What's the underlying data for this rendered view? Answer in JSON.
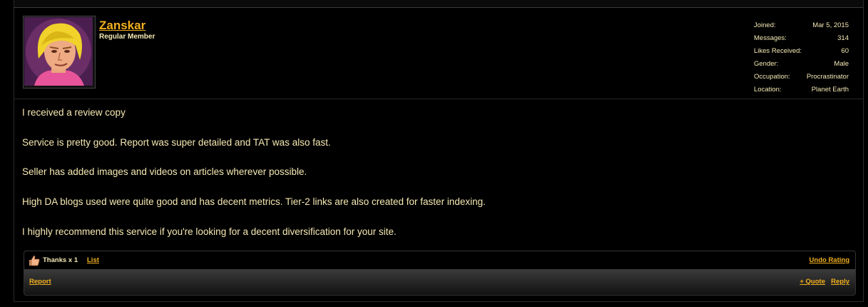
{
  "user": {
    "name": "Zanskar",
    "title": "Regular Member",
    "avatar_icon": "cartoon-hero-avatar",
    "stats": [
      {
        "label": "Joined:",
        "value": "Mar 5, 2015"
      },
      {
        "label": "Messages:",
        "value": "314"
      },
      {
        "label": "Likes Received:",
        "value": "60"
      },
      {
        "label": "Gender:",
        "value": "Male"
      },
      {
        "label": "Occupation:",
        "value": "Procrastinator"
      },
      {
        "label": "Location:",
        "value": "Planet Earth"
      }
    ]
  },
  "post": {
    "paragraphs": [
      "I received a review copy",
      "Service is pretty good. Report was super detailed and TAT was also fast.",
      "Seller has added images and videos on articles wherever possible.",
      "High DA blogs used were quite good and has decent metrics. Tier-2 links are also created for faster indexing.",
      "I highly recommend this service if you're looking for a decent diversification for your site."
    ]
  },
  "likes": {
    "icon": "thumbs-up-icon",
    "text": "Thanks x 1",
    "list_label": "List",
    "undo_label": "Undo Rating"
  },
  "controls": {
    "report_label": "Report",
    "quote_label": "+ Quote",
    "reply_label": "Reply"
  },
  "colors": {
    "background": "#000000",
    "link": "#f2b01e",
    "text": "#f6e9b2"
  }
}
